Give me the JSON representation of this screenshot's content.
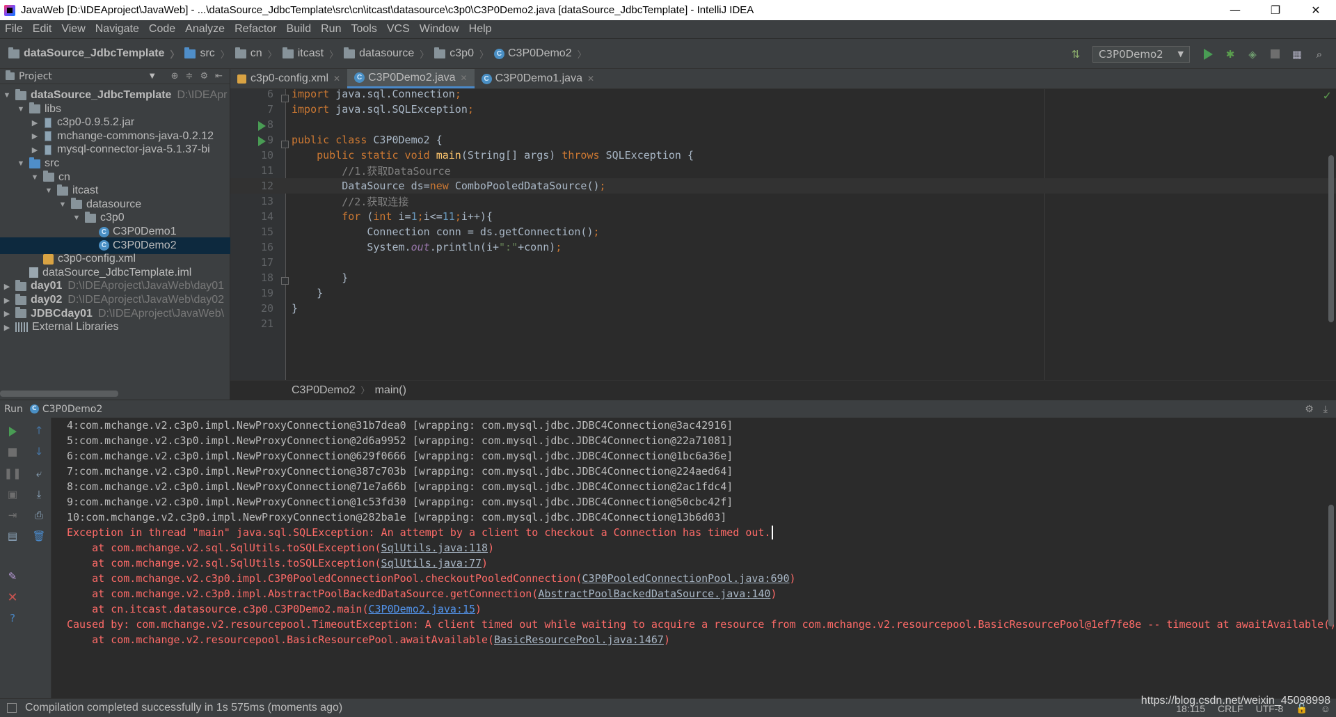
{
  "window": {
    "title": "JavaWeb [D:\\IDEAproject\\JavaWeb] - ...\\dataSource_JdbcTemplate\\src\\cn\\itcast\\datasource\\c3p0\\C3P0Demo2.java [dataSource_JdbcTemplate] - IntelliJ IDEA",
    "minimize": "—",
    "restore": "❐",
    "close": "✕"
  },
  "menu": [
    "File",
    "Edit",
    "View",
    "Navigate",
    "Code",
    "Analyze",
    "Refactor",
    "Build",
    "Run",
    "Tools",
    "VCS",
    "Window",
    "Help"
  ],
  "navbar": {
    "crumbs": [
      "dataSource_JdbcTemplate",
      "src",
      "cn",
      "itcast",
      "datasource",
      "c3p0",
      "C3P0Demo2"
    ],
    "run_config": "C3P0Demo2"
  },
  "project": {
    "header": "Project",
    "tree": [
      {
        "label": "dataSource_JdbcTemplate",
        "path": "D:\\IDEApr",
        "arrow": "▼",
        "indent": 0,
        "icon": "module",
        "bold": true
      },
      {
        "label": "libs",
        "arrow": "▼",
        "indent": 1,
        "icon": "folder"
      },
      {
        "label": "c3p0-0.9.5.2.jar",
        "arrow": "▶",
        "indent": 2,
        "icon": "jar"
      },
      {
        "label": "mchange-commons-java-0.2.12",
        "arrow": "▶",
        "indent": 2,
        "icon": "jar"
      },
      {
        "label": "mysql-connector-java-5.1.37-bi",
        "arrow": "▶",
        "indent": 2,
        "icon": "jar"
      },
      {
        "label": "src",
        "arrow": "▼",
        "indent": 1,
        "icon": "source-folder"
      },
      {
        "label": "cn",
        "arrow": "▼",
        "indent": 2,
        "icon": "package"
      },
      {
        "label": "itcast",
        "arrow": "▼",
        "indent": 3,
        "icon": "package"
      },
      {
        "label": "datasource",
        "arrow": "▼",
        "indent": 4,
        "icon": "package"
      },
      {
        "label": "c3p0",
        "arrow": "▼",
        "indent": 5,
        "icon": "package"
      },
      {
        "label": "C3P0Demo1",
        "arrow": "",
        "indent": 6,
        "icon": "class"
      },
      {
        "label": "C3P0Demo2",
        "arrow": "",
        "indent": 6,
        "icon": "class",
        "selected": true
      },
      {
        "label": "c3p0-config.xml",
        "arrow": "",
        "indent": 2,
        "icon": "xml"
      },
      {
        "label": "dataSource_JdbcTemplate.iml",
        "arrow": "",
        "indent": 1,
        "icon": "iml"
      },
      {
        "label": "day01",
        "path": "D:\\IDEAproject\\JavaWeb\\day01",
        "arrow": "▶",
        "indent": 0,
        "icon": "module",
        "bold": true
      },
      {
        "label": "day02",
        "path": "D:\\IDEAproject\\JavaWeb\\day02",
        "arrow": "▶",
        "indent": 0,
        "icon": "module",
        "bold": true
      },
      {
        "label": "JDBCday01",
        "path": "D:\\IDEAproject\\JavaWeb\\",
        "arrow": "▶",
        "indent": 0,
        "icon": "module",
        "bold": true
      },
      {
        "label": "External Libraries",
        "arrow": "▶",
        "indent": 0,
        "icon": "libraries"
      }
    ]
  },
  "tabs": [
    {
      "label": "c3p0-config.xml",
      "icon": "xml",
      "active": false
    },
    {
      "label": "C3P0Demo2.java",
      "icon": "class",
      "active": true
    },
    {
      "label": "C3P0Demo1.java",
      "icon": "class",
      "active": false
    }
  ],
  "editor": {
    "lines": [
      {
        "n": "6",
        "segs": [
          [
            "kw",
            "import "
          ],
          [
            "",
            "java.sql.Connection"
          ],
          [
            "kw",
            ";"
          ]
        ]
      },
      {
        "n": "7",
        "segs": [
          [
            "kw",
            "import "
          ],
          [
            "",
            "java.sql.SQLException"
          ],
          [
            "kw",
            ";"
          ]
        ]
      },
      {
        "n": "8",
        "segs": []
      },
      {
        "n": "9",
        "segs": [
          [
            "kw",
            "public class "
          ],
          [
            "",
            "C3P0Demo2 {"
          ]
        ]
      },
      {
        "n": "10",
        "segs": [
          [
            "",
            "    "
          ],
          [
            "kw",
            "public static void "
          ],
          [
            "fn",
            "main"
          ],
          [
            "",
            "(String[] args) "
          ],
          [
            "kw",
            "throws "
          ],
          [
            "",
            "SQLException {"
          ]
        ]
      },
      {
        "n": "11",
        "segs": [
          [
            "",
            "        "
          ],
          [
            "cm",
            "//1.获取DataSource"
          ]
        ]
      },
      {
        "n": "12",
        "segs": [
          [
            "",
            "        DataSource ds="
          ],
          [
            "kw",
            "new "
          ],
          [
            "",
            "ComboPooledDataSource()"
          ],
          [
            "kw",
            ";"
          ]
        ],
        "current": true
      },
      {
        "n": "13",
        "segs": [
          [
            "",
            "        "
          ],
          [
            "cm",
            "//2.获取连接"
          ]
        ]
      },
      {
        "n": "14",
        "segs": [
          [
            "",
            "        "
          ],
          [
            "kw",
            "for "
          ],
          [
            "",
            "("
          ],
          [
            "kw",
            "int "
          ],
          [
            "",
            "i="
          ],
          [
            "num",
            "1"
          ],
          [
            "kw",
            ";"
          ],
          [
            "",
            "i<="
          ],
          [
            "num",
            "11"
          ],
          [
            "kw",
            ";"
          ],
          [
            "",
            "i++){"
          ]
        ]
      },
      {
        "n": "15",
        "segs": [
          [
            "",
            "            Connection conn = ds.getConnection()"
          ],
          [
            "kw",
            ";"
          ]
        ]
      },
      {
        "n": "16",
        "segs": [
          [
            "",
            "            System."
          ],
          [
            "field",
            "out"
          ],
          [
            "",
            ".println(i+"
          ],
          [
            "st",
            "\":\""
          ],
          [
            "",
            "+conn)"
          ],
          [
            "kw",
            ";"
          ]
        ]
      },
      {
        "n": "17",
        "segs": []
      },
      {
        "n": "18",
        "segs": [
          [
            "",
            "        }"
          ]
        ]
      },
      {
        "n": "19",
        "segs": [
          [
            "",
            "    }"
          ]
        ]
      },
      {
        "n": "20",
        "segs": [
          [
            "",
            "}"
          ]
        ]
      },
      {
        "n": "21",
        "segs": []
      }
    ],
    "breadcrumb": [
      "C3P0Demo2",
      "main()"
    ]
  },
  "run": {
    "label": "Run",
    "config": "C3P0Demo2",
    "output": [
      {
        "type": "out",
        "text": "4:com.mchange.v2.c3p0.impl.NewProxyConnection@31b7dea0 [wrapping: com.mysql.jdbc.JDBC4Connection@3ac42916]"
      },
      {
        "type": "out",
        "text": "5:com.mchange.v2.c3p0.impl.NewProxyConnection@2d6a9952 [wrapping: com.mysql.jdbc.JDBC4Connection@22a71081]"
      },
      {
        "type": "out",
        "text": "6:com.mchange.v2.c3p0.impl.NewProxyConnection@629f0666 [wrapping: com.mysql.jdbc.JDBC4Connection@1bc6a36e]"
      },
      {
        "type": "out",
        "text": "7:com.mchange.v2.c3p0.impl.NewProxyConnection@387c703b [wrapping: com.mysql.jdbc.JDBC4Connection@224aed64]"
      },
      {
        "type": "out",
        "text": "8:com.mchange.v2.c3p0.impl.NewProxyConnection@71e7a66b [wrapping: com.mysql.jdbc.JDBC4Connection@2ac1fdc4]"
      },
      {
        "type": "out",
        "text": "9:com.mchange.v2.c3p0.impl.NewProxyConnection@1c53fd30 [wrapping: com.mysql.jdbc.JDBC4Connection@50cbc42f]"
      },
      {
        "type": "out",
        "text": "10:com.mchange.v2.c3p0.impl.NewProxyConnection@282ba1e [wrapping: com.mysql.jdbc.JDBC4Connection@13b6d03]"
      },
      {
        "type": "err",
        "text": "Exception in thread \"main\" java.sql.SQLException: An attempt by a client to checkout a Connection has timed out.",
        "caret": true
      },
      {
        "type": "err",
        "text": "    at com.mchange.v2.sql.SqlUtils.toSQLException(",
        "link": "SqlUtils.java:118",
        "tail": ")"
      },
      {
        "type": "err",
        "text": "    at com.mchange.v2.sql.SqlUtils.toSQLException(",
        "link": "SqlUtils.java:77",
        "tail": ")"
      },
      {
        "type": "err",
        "text": "    at com.mchange.v2.c3p0.impl.C3P0PooledConnectionPool.checkoutPooledConnection(",
        "link": "C3P0PooledConnectionPool.java:690",
        "tail": ")"
      },
      {
        "type": "err",
        "text": "    at com.mchange.v2.c3p0.impl.AbstractPoolBackedDataSource.getConnection(",
        "link": "AbstractPoolBackedDataSource.java:140",
        "tail": ")"
      },
      {
        "type": "err",
        "text": "    at cn.itcast.datasource.c3p0.C3P0Demo2.main(",
        "link": "C3P0Demo2.java:15",
        "tail": ")",
        "bluelink": true
      },
      {
        "type": "err",
        "text": "Caused by: com.mchange.v2.resourcepool.TimeoutException: A client timed out while waiting to acquire a resource from com.mchange.v2.resourcepool.BasicResourcePool@1ef7fe8e -- timeout at awaitAvailable()"
      },
      {
        "type": "err",
        "text": "    at com.mchange.v2.resourcepool.BasicResourcePool.awaitAvailable(",
        "link": "BasicResourcePool.java:1467",
        "tail": ")"
      }
    ]
  },
  "status": {
    "message": "Compilation completed successfully in 1s 575ms (moments ago)",
    "position": "18:115",
    "line_sep": "CRLF",
    "encoding": "UTF-8",
    "watermark": "https://blog.csdn.net/weixin_45098998"
  }
}
